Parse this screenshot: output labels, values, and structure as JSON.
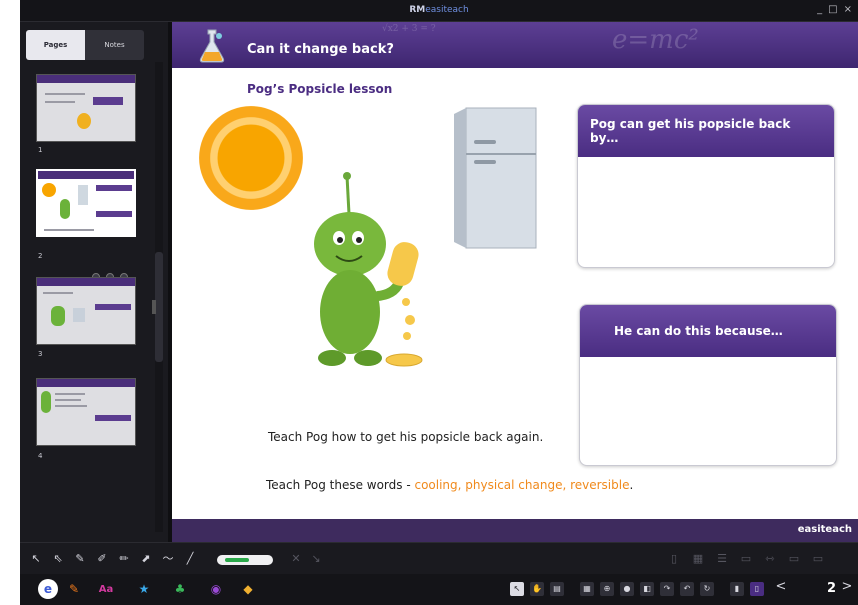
{
  "window": {
    "title_prefix": "RM",
    "title_brand": "easiteach",
    "controls": [
      "_",
      "□",
      "×"
    ]
  },
  "left_panel": {
    "tabs": [
      {
        "label": "Pages",
        "active": true
      },
      {
        "label": "Notes",
        "active": false
      }
    ],
    "pages": [
      {
        "number": "1",
        "selected": false
      },
      {
        "number": "2",
        "selected": true
      },
      {
        "number": "3",
        "selected": false
      },
      {
        "number": "4",
        "selected": false
      }
    ]
  },
  "slide": {
    "title": "Can it change back?",
    "header_equation": "e=mc²",
    "header_formula": "√x2 + 3 = ?",
    "subtitle": "Pog’s Popsicle lesson",
    "card1": "Pog can get his popsicle back by…",
    "card2": "He can do this because…",
    "instruction": "Teach Pog how to get his popsicle back again.",
    "words_intro": "Teach Pog these words - ",
    "words": "cooling, physical change, reversible",
    "words_end": ".",
    "footer_brand": "easiteach"
  },
  "taskbar": {
    "page_number": "2",
    "prev_arrow": "<",
    "next_arrow": ">"
  },
  "colors": {
    "header_purple": "#4a2d82",
    "accent_orange": "#f08a1c",
    "panel_dark": "#1a1a1f"
  }
}
